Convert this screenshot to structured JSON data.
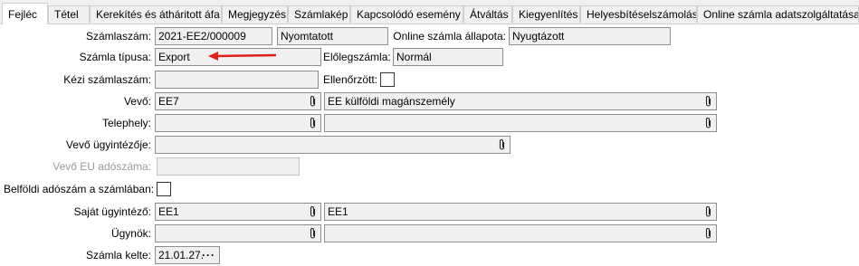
{
  "tabs": [
    "Fejléc",
    "Tétel",
    "Kerekítés és átháritott áfa",
    "Megjegyzés",
    "Számlakép",
    "Kapcsolódó esemény",
    "Átváltás",
    "Kiegyenlítés",
    "Helyesbítéselszámolás",
    "Online számla adatszolgáltatása"
  ],
  "form": {
    "invoice_number_label": "Számlaszám:",
    "invoice_number": "2021-EE2/000009",
    "print_status": "Nyomtatott",
    "online_status_label": "Online számla állapota:",
    "online_status": "Nyugtázott",
    "invoice_type_label": "Számla típusa:",
    "invoice_type": "Export",
    "advance_invoice_label": "Előlegszámla:",
    "advance_invoice": "Normál",
    "manual_number_label": "Kézi számlaszám:",
    "manual_number": "",
    "checked_label": "Ellenőrzött:",
    "customer_label": "Vevő:",
    "customer_code": "EE7",
    "customer_name": "EE külföldi magánszemély",
    "site_label": "Telephely:",
    "site_code": "",
    "site_name": "",
    "customer_agent_label": "Vevő ügyintézője:",
    "customer_agent": "",
    "customer_eu_tax_label": "Vevő EU adószáma:",
    "customer_eu_tax": "",
    "domestic_tax_label": "Belföldi adószám a számlában:",
    "own_agent_label": "Saját ügyintéző:",
    "own_agent_code": "EE1",
    "own_agent_name": "EE1",
    "agent_label": "Ügynök:",
    "agent_code": "",
    "agent_name": "",
    "invoice_date_label": "Számla kelte:",
    "invoice_date": "21.01.27.",
    "date_picker_dots": "···"
  },
  "colors": {
    "arrow": "#e0201b"
  },
  "icons": {
    "lookup": "paperclip-icon"
  }
}
